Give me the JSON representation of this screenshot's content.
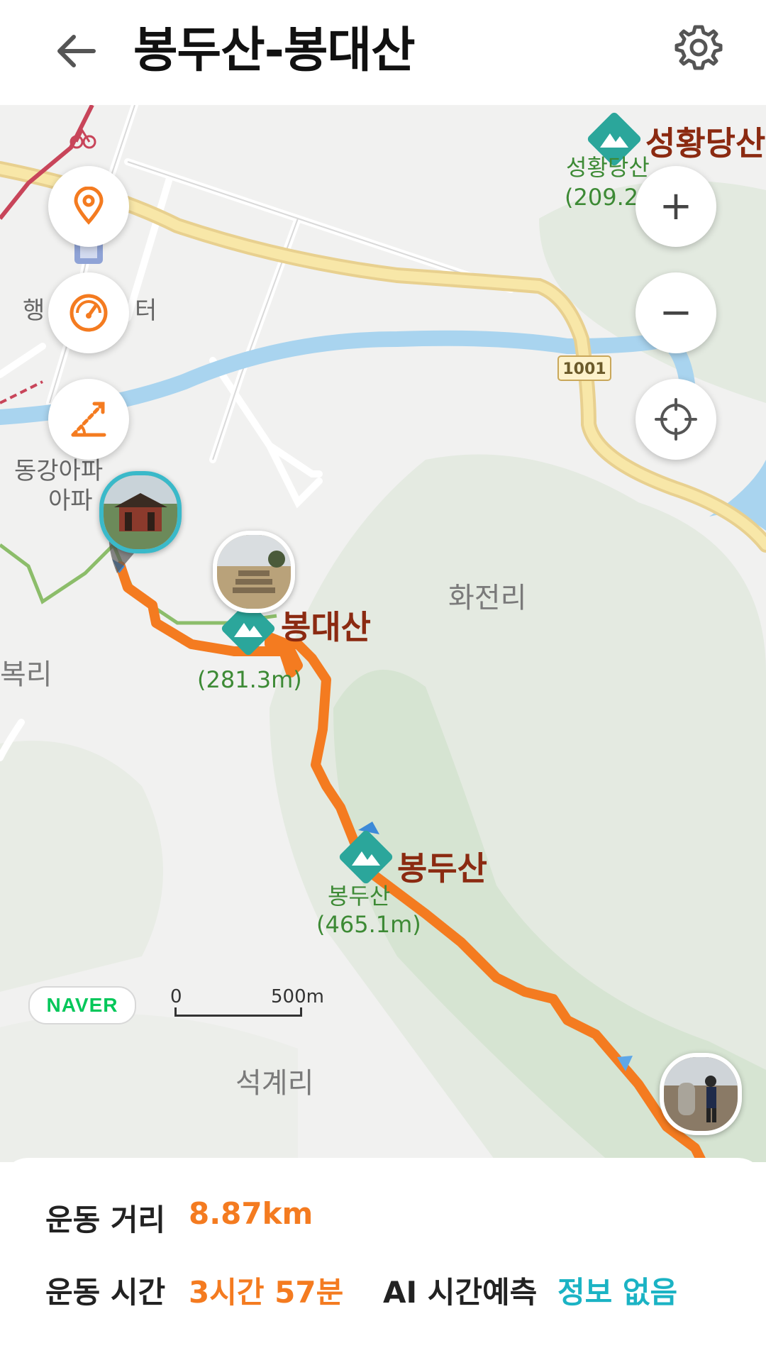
{
  "header": {
    "title": "봉두산-봉대산",
    "back_icon": "arrow-left-icon",
    "settings_icon": "gear-icon"
  },
  "map": {
    "labels": {
      "hwajeonri": "화전리",
      "seokgyeri": "석계리",
      "bokri": "복리",
      "donggang": "동강아파",
      "apa": "아파",
      "haeng": "행",
      "center": "터",
      "road_number": "1001"
    },
    "peaks": {
      "bongdaesan": {
        "name": "봉대산",
        "sub": "(281.3m)"
      },
      "bongdusan": {
        "name": "봉두산",
        "sub_name": "봉두산",
        "sub": "(465.1m)"
      },
      "seonghwangdang": {
        "name": "성황당산",
        "sub_name": "성황당산",
        "sub": "(209.2m)"
      }
    },
    "buttons": {
      "location": "pin-icon",
      "speed": "speedometer-icon",
      "slope": "slope-icon",
      "zoom_in": "+",
      "zoom_out": "−",
      "recenter": "crosshair-icon"
    },
    "naver_badge": "NAVER",
    "scale": {
      "zero": "0",
      "distance": "500m"
    }
  },
  "info": {
    "distance_label": "운동 거리",
    "distance_value": "8.87km",
    "time_label": "운동 시간",
    "time_value": "3시간 57분",
    "ai_label": "AI 시간예측",
    "ai_value": "정보 없음"
  },
  "colors": {
    "route": "#f47b20",
    "accent_teal": "#1bb3c4",
    "peak_marker": "#2ba69b",
    "peak_name": "#8b2a11"
  }
}
